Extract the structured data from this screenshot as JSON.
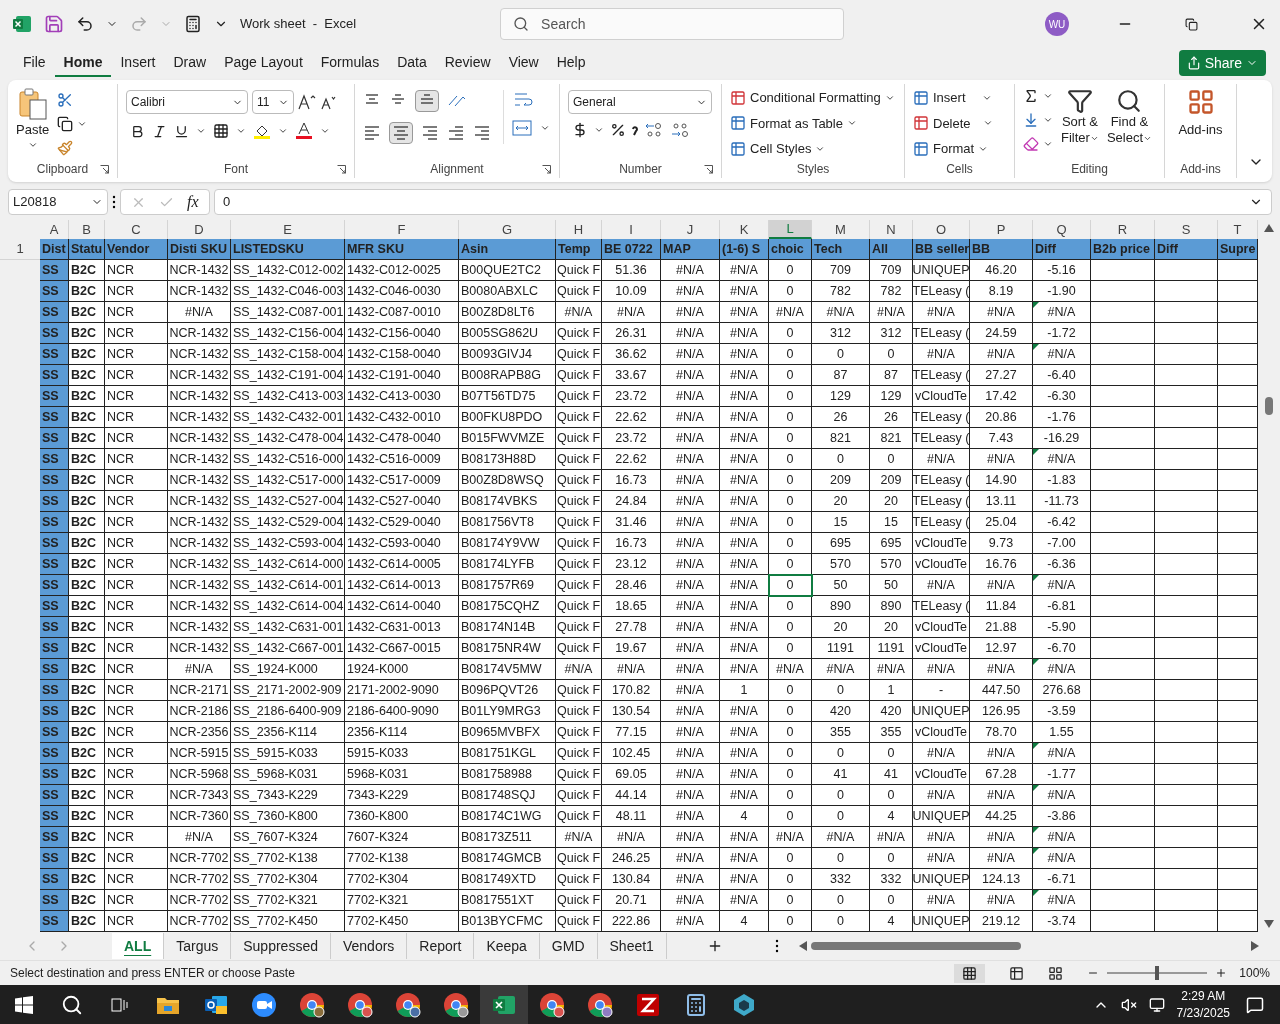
{
  "title_bar": {
    "title": "Work sheet  -  Excel",
    "search_placeholder": "Search",
    "avatar": "WU"
  },
  "menu_tabs": [
    {
      "label": "File",
      "selected": false
    },
    {
      "label": "Home",
      "selected": true
    },
    {
      "label": "Insert",
      "selected": false
    },
    {
      "label": "Draw",
      "selected": false
    },
    {
      "label": "Page Layout",
      "selected": false
    },
    {
      "label": "Formulas",
      "selected": false
    },
    {
      "label": "Data",
      "selected": false
    },
    {
      "label": "Review",
      "selected": false
    },
    {
      "label": "View",
      "selected": false
    },
    {
      "label": "Help",
      "selected": false
    }
  ],
  "share": "Share",
  "ribbon": {
    "paste": "Paste",
    "font_name": "Calibri",
    "font_size": "11",
    "number_format": "General",
    "conditional_formatting": "Conditional Formatting",
    "format_as_table": "Format as Table",
    "cell_styles": "Cell Styles",
    "insert": "Insert",
    "delete": "Delete",
    "format": "Format",
    "sort_filter": [
      "Sort &",
      "Filter"
    ],
    "find_select": [
      "Find &",
      "Select"
    ],
    "add_ins": "Add-ins",
    "groups": [
      "Clipboard",
      "Font",
      "Alignment",
      "Number",
      "Styles",
      "Cells",
      "Editing",
      "Add-ins"
    ]
  },
  "formula_bar": {
    "name_box": "L20818",
    "fx_label": "fx",
    "value": "0"
  },
  "columns": [
    {
      "letter": "A",
      "selected": false
    },
    {
      "letter": "B",
      "selected": false
    },
    {
      "letter": "C",
      "selected": false
    },
    {
      "letter": "D",
      "selected": false
    },
    {
      "letter": "E",
      "selected": false
    },
    {
      "letter": "F",
      "selected": false
    },
    {
      "letter": "G",
      "selected": false
    },
    {
      "letter": "H",
      "selected": false
    },
    {
      "letter": "I",
      "selected": false
    },
    {
      "letter": "J",
      "selected": false
    },
    {
      "letter": "K",
      "selected": false
    },
    {
      "letter": "L",
      "selected": true
    },
    {
      "letter": "M",
      "selected": false
    },
    {
      "letter": "N",
      "selected": false
    },
    {
      "letter": "O",
      "selected": false
    },
    {
      "letter": "P",
      "selected": false
    },
    {
      "letter": "Q",
      "selected": false
    },
    {
      "letter": "R",
      "selected": false
    },
    {
      "letter": "S",
      "selected": false
    },
    {
      "letter": "T",
      "selected": false
    }
  ],
  "header_row": {
    "number": "1",
    "cells": [
      "Dist",
      "Statu",
      "Vendor",
      "Disti SKU",
      "LISTEDSKU",
      "MFR SKU",
      "Asin",
      "Temp",
      "BE 0722",
      "MAP",
      "(1-6) S",
      "choic",
      "Tech",
      "All",
      "BB seller",
      "BB",
      "Diff",
      "B2b price",
      "Diff",
      "Supre"
    ]
  },
  "rows": [
    {
      "cells": [
        "SS",
        "B2C",
        "NCR",
        "NCR-1432",
        "SS_1432-C012-002",
        "1432-C012-0025",
        "B00QUE2TC2",
        "Quick F",
        "51.36",
        "#N/A",
        "#N/A",
        "0",
        "709",
        "709",
        "UNIQUEP",
        "46.20",
        "-5.16"
      ],
      "selected": false,
      "flagged": false
    },
    {
      "cells": [
        "SS",
        "B2C",
        "NCR",
        "NCR-1432",
        "SS_1432-C046-003",
        "1432-C046-0030",
        "B0080ABXLC",
        "Quick F",
        "10.09",
        "#N/A",
        "#N/A",
        "0",
        "782",
        "782",
        "TELeasy (",
        "8.19",
        "-1.90"
      ],
      "selected": false,
      "flagged": false
    },
    {
      "cells": [
        "SS",
        "B2C",
        "NCR",
        "#N/A",
        "SS_1432-C087-001",
        "1432-C087-0010",
        "B00Z8D8LT6",
        "#N/A",
        "#N/A",
        "#N/A",
        "#N/A",
        "#N/A",
        "#N/A",
        "#N/A",
        "#N/A",
        "#N/A",
        "#N/A"
      ],
      "selected": false,
      "flagged": true
    },
    {
      "cells": [
        "SS",
        "B2C",
        "NCR",
        "NCR-1432",
        "SS_1432-C156-004",
        "1432-C156-0040",
        "B005SG862U",
        "Quick F",
        "26.31",
        "#N/A",
        "#N/A",
        "0",
        "312",
        "312",
        "TELeasy (",
        "24.59",
        "-1.72"
      ],
      "selected": false,
      "flagged": false
    },
    {
      "cells": [
        "SS",
        "B2C",
        "NCR",
        "NCR-1432",
        "SS_1432-C158-004",
        "1432-C158-0040",
        "B0093GIVJ4",
        "Quick F",
        "36.62",
        "#N/A",
        "#N/A",
        "0",
        "0",
        "0",
        "#N/A",
        "#N/A",
        "#N/A"
      ],
      "selected": false,
      "flagged": true
    },
    {
      "cells": [
        "SS",
        "B2C",
        "NCR",
        "NCR-1432",
        "SS_1432-C191-004",
        "1432-C191-0040",
        "B008RAPB8G",
        "Quick F",
        "33.67",
        "#N/A",
        "#N/A",
        "0",
        "87",
        "87",
        "TELeasy (",
        "27.27",
        "-6.40"
      ],
      "selected": false,
      "flagged": false
    },
    {
      "cells": [
        "SS",
        "B2C",
        "NCR",
        "NCR-1432",
        "SS_1432-C413-003",
        "1432-C413-0030",
        "B07T56TD75",
        "Quick F",
        "23.72",
        "#N/A",
        "#N/A",
        "0",
        "129",
        "129",
        "vCloudTe",
        "17.42",
        "-6.30"
      ],
      "selected": false,
      "flagged": false
    },
    {
      "cells": [
        "SS",
        "B2C",
        "NCR",
        "NCR-1432",
        "SS_1432-C432-001",
        "1432-C432-0010",
        "B00FKU8PDO",
        "Quick F",
        "22.62",
        "#N/A",
        "#N/A",
        "0",
        "26",
        "26",
        "TELeasy (",
        "20.86",
        "-1.76"
      ],
      "selected": false,
      "flagged": false
    },
    {
      "cells": [
        "SS",
        "B2C",
        "NCR",
        "NCR-1432",
        "SS_1432-C478-004",
        "1432-C478-0040",
        "B015FWVMZE",
        "Quick F",
        "23.72",
        "#N/A",
        "#N/A",
        "0",
        "821",
        "821",
        "TELeasy (",
        "7.43",
        "-16.29"
      ],
      "selected": false,
      "flagged": false
    },
    {
      "cells": [
        "SS",
        "B2C",
        "NCR",
        "NCR-1432",
        "SS_1432-C516-000",
        "1432-C516-0009",
        "B08173H88D",
        "Quick F",
        "22.62",
        "#N/A",
        "#N/A",
        "0",
        "0",
        "0",
        "#N/A",
        "#N/A",
        "#N/A"
      ],
      "selected": false,
      "flagged": true
    },
    {
      "cells": [
        "SS",
        "B2C",
        "NCR",
        "NCR-1432",
        "SS_1432-C517-000",
        "1432-C517-0009",
        "B00Z8D8WSQ",
        "Quick F",
        "16.73",
        "#N/A",
        "#N/A",
        "0",
        "209",
        "209",
        "TELeasy (",
        "14.90",
        "-1.83"
      ],
      "selected": false,
      "flagged": false
    },
    {
      "cells": [
        "SS",
        "B2C",
        "NCR",
        "NCR-1432",
        "SS_1432-C527-004",
        "1432-C527-0040",
        "B08174VBKS",
        "Quick F",
        "24.84",
        "#N/A",
        "#N/A",
        "0",
        "20",
        "20",
        "TELeasy (",
        "13.11",
        "-11.73"
      ],
      "selected": false,
      "flagged": false
    },
    {
      "cells": [
        "SS",
        "B2C",
        "NCR",
        "NCR-1432",
        "SS_1432-C529-004",
        "1432-C529-0040",
        "B081756VT8",
        "Quick F",
        "31.46",
        "#N/A",
        "#N/A",
        "0",
        "15",
        "15",
        "TELeasy (",
        "25.04",
        "-6.42"
      ],
      "selected": false,
      "flagged": false
    },
    {
      "cells": [
        "SS",
        "B2C",
        "NCR",
        "NCR-1432",
        "SS_1432-C593-004",
        "1432-C593-0040",
        "B08174Y9VW",
        "Quick F",
        "16.73",
        "#N/A",
        "#N/A",
        "0",
        "695",
        "695",
        "vCloudTe",
        "9.73",
        "-7.00"
      ],
      "selected": false,
      "flagged": false
    },
    {
      "cells": [
        "SS",
        "B2C",
        "NCR",
        "NCR-1432",
        "SS_1432-C614-000",
        "1432-C614-0005",
        "B08174LYFB",
        "Quick F",
        "23.12",
        "#N/A",
        "#N/A",
        "0",
        "570",
        "570",
        "vCloudTe",
        "16.76",
        "-6.36"
      ],
      "selected": false,
      "flagged": false
    },
    {
      "cells": [
        "SS",
        "B2C",
        "NCR",
        "NCR-1432",
        "SS_1432-C614-001",
        "1432-C614-0013",
        "B081757R69",
        "Quick F",
        "28.46",
        "#N/A",
        "#N/A",
        "0",
        "50",
        "50",
        "#N/A",
        "#N/A",
        "#N/A"
      ],
      "selected": true,
      "flagged": true
    },
    {
      "cells": [
        "SS",
        "B2C",
        "NCR",
        "NCR-1432",
        "SS_1432-C614-004",
        "1432-C614-0040",
        "B08175CQHZ",
        "Quick F",
        "18.65",
        "#N/A",
        "#N/A",
        "0",
        "890",
        "890",
        "TELeasy (",
        "11.84",
        "-6.81"
      ],
      "selected": false,
      "flagged": false
    },
    {
      "cells": [
        "SS",
        "B2C",
        "NCR",
        "NCR-1432",
        "SS_1432-C631-001",
        "1432-C631-0013",
        "B08174N14B",
        "Quick F",
        "27.78",
        "#N/A",
        "#N/A",
        "0",
        "20",
        "20",
        "vCloudTe",
        "21.88",
        "-5.90"
      ],
      "selected": false,
      "flagged": false
    },
    {
      "cells": [
        "SS",
        "B2C",
        "NCR",
        "NCR-1432",
        "SS_1432-C667-001",
        "1432-C667-0015",
        "B08175NR4W",
        "Quick F",
        "19.67",
        "#N/A",
        "#N/A",
        "0",
        "1191",
        "1191",
        "vCloudTe",
        "12.97",
        "-6.70"
      ],
      "selected": false,
      "flagged": false
    },
    {
      "cells": [
        "SS",
        "B2C",
        "NCR",
        "#N/A",
        "SS_1924-K000",
        "1924-K000",
        "B08174V5MW",
        "#N/A",
        "#N/A",
        "#N/A",
        "#N/A",
        "#N/A",
        "#N/A",
        "#N/A",
        "#N/A",
        "#N/A",
        "#N/A"
      ],
      "selected": false,
      "flagged": true
    },
    {
      "cells": [
        "SS",
        "B2C",
        "NCR",
        "NCR-2171",
        "SS_2171-2002-909",
        "2171-2002-9090",
        "B096PQVT26",
        "Quick F",
        "170.82",
        "#N/A",
        "1",
        "0",
        "0",
        "1",
        "-",
        "447.50",
        "276.68"
      ],
      "selected": false,
      "flagged": false
    },
    {
      "cells": [
        "SS",
        "B2C",
        "NCR",
        "NCR-2186",
        "SS_2186-6400-909",
        "2186-6400-9090",
        "B01LY9MRG3",
        "Quick F",
        "130.54",
        "#N/A",
        "#N/A",
        "0",
        "420",
        "420",
        "UNIQUEP",
        "126.95",
        "-3.59"
      ],
      "selected": false,
      "flagged": false
    },
    {
      "cells": [
        "SS",
        "B2C",
        "NCR",
        "NCR-2356",
        "SS_2356-K114",
        "2356-K114",
        "B0965MVBFX",
        "Quick F",
        "77.15",
        "#N/A",
        "#N/A",
        "0",
        "355",
        "355",
        "vCloudTe",
        "78.70",
        "1.55"
      ],
      "selected": false,
      "flagged": false
    },
    {
      "cells": [
        "SS",
        "B2C",
        "NCR",
        "NCR-5915",
        "SS_5915-K033",
        "5915-K033",
        "B081751KGL",
        "Quick F",
        "102.45",
        "#N/A",
        "#N/A",
        "0",
        "0",
        "0",
        "#N/A",
        "#N/A",
        "#N/A"
      ],
      "selected": false,
      "flagged": true
    },
    {
      "cells": [
        "SS",
        "B2C",
        "NCR",
        "NCR-5968",
        "SS_5968-K031",
        "5968-K031",
        "B081758988",
        "Quick F",
        "69.05",
        "#N/A",
        "#N/A",
        "0",
        "41",
        "41",
        "vCloudTe",
        "67.28",
        "-1.77"
      ],
      "selected": false,
      "flagged": false
    },
    {
      "cells": [
        "SS",
        "B2C",
        "NCR",
        "NCR-7343",
        "SS_7343-K229",
        "7343-K229",
        "B081748SQJ",
        "Quick F",
        "44.14",
        "#N/A",
        "#N/A",
        "0",
        "0",
        "0",
        "#N/A",
        "#N/A",
        "#N/A"
      ],
      "selected": false,
      "flagged": true
    },
    {
      "cells": [
        "SS",
        "B2C",
        "NCR",
        "NCR-7360",
        "SS_7360-K800",
        "7360-K800",
        "B08174C1WG",
        "Quick F",
        "48.11",
        "#N/A",
        "4",
        "0",
        "0",
        "4",
        "UNIQUEP",
        "44.25",
        "-3.86"
      ],
      "selected": false,
      "flagged": false
    },
    {
      "cells": [
        "SS",
        "B2C",
        "NCR",
        "#N/A",
        "SS_7607-K324",
        "7607-K324",
        "B08173Z511",
        "#N/A",
        "#N/A",
        "#N/A",
        "#N/A",
        "#N/A",
        "#N/A",
        "#N/A",
        "#N/A",
        "#N/A",
        "#N/A"
      ],
      "selected": false,
      "flagged": true
    },
    {
      "cells": [
        "SS",
        "B2C",
        "NCR",
        "NCR-7702",
        "SS_7702-K138",
        "7702-K138",
        "B08174GMCB",
        "Quick F",
        "246.25",
        "#N/A",
        "#N/A",
        "0",
        "0",
        "0",
        "#N/A",
        "#N/A",
        "#N/A"
      ],
      "selected": false,
      "flagged": true
    },
    {
      "cells": [
        "SS",
        "B2C",
        "NCR",
        "NCR-7702",
        "SS_7702-K304",
        "7702-K304",
        "B081749XTD",
        "Quick F",
        "130.84",
        "#N/A",
        "#N/A",
        "0",
        "332",
        "332",
        "UNIQUEP",
        "124.13",
        "-6.71"
      ],
      "selected": false,
      "flagged": false
    },
    {
      "cells": [
        "SS",
        "B2C",
        "NCR",
        "NCR-7702",
        "SS_7702-K321",
        "7702-K321",
        "B0817551XT",
        "Quick F",
        "20.71",
        "#N/A",
        "#N/A",
        "0",
        "0",
        "0",
        "#N/A",
        "#N/A",
        "#N/A"
      ],
      "selected": false,
      "flagged": true
    },
    {
      "cells": [
        "SS",
        "B2C",
        "NCR",
        "NCR-7702",
        "SS_7702-K450",
        "7702-K450",
        "B013BYCFMC",
        "Quick F",
        "222.86",
        "#N/A",
        "4",
        "0",
        "0",
        "4",
        "UNIQUEP",
        "219.12",
        "-3.74"
      ],
      "selected": false,
      "flagged": false
    }
  ],
  "sheet_tabs": [
    {
      "label": "ALL",
      "selected": true
    },
    {
      "label": "Targus",
      "selected": false
    },
    {
      "label": "Suppressed",
      "selected": false
    },
    {
      "label": "Vendors",
      "selected": false
    },
    {
      "label": "Report",
      "selected": false
    },
    {
      "label": "Keepa",
      "selected": false
    },
    {
      "label": "GMD",
      "selected": false
    },
    {
      "label": "Sheet1",
      "selected": false
    }
  ],
  "status_bar": {
    "message": "Select destination and press ENTER or choose Paste",
    "zoom": "100%",
    "zoom_slider": {
      "level": 0.5
    }
  },
  "taskbar": {
    "time": "2:29 AM",
    "date": "7/23/2025"
  }
}
